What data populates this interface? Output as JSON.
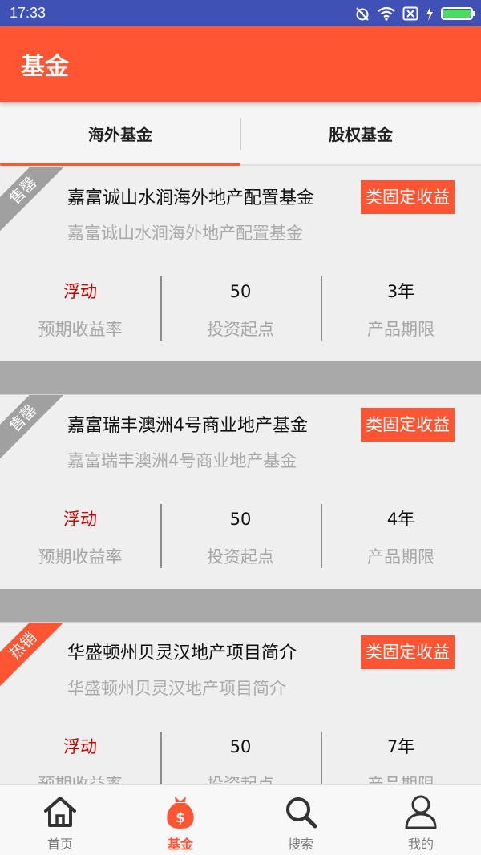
{
  "status_bar": {
    "time": "17:33",
    "battery_color": "#4cd964"
  },
  "app_bar": {
    "title": "基金",
    "color": "#ff5533"
  },
  "tabs": [
    {
      "label": "海外基金",
      "active": true
    },
    {
      "label": "股权基金",
      "active": false
    }
  ],
  "funds": [
    {
      "ribbon": "售罄",
      "name": "嘉富诚山水涧海外地产配置基金",
      "subtitle": "嘉富诚山水涧海外地产配置基金",
      "badge": "类固定收益",
      "stats": [
        {
          "value": "浮动",
          "label": "预期收益率"
        },
        {
          "value": "50",
          "label": "投资起点"
        },
        {
          "value": "3年",
          "label": "产品期限"
        }
      ]
    },
    {
      "ribbon": "售罄",
      "name": "嘉富瑞丰澳洲4号商业地产基金",
      "subtitle": "嘉富瑞丰澳洲4号商业地产基金",
      "badge": "类固定收益",
      "stats": [
        {
          "value": "浮动",
          "label": "预期收益率"
        },
        {
          "value": "50",
          "label": "投资起点"
        },
        {
          "value": "4年",
          "label": "产品期限"
        }
      ]
    },
    {
      "ribbon": "热销",
      "name": "华盛顿州贝灵汉地产项目简介",
      "subtitle": "华盛顿州贝灵汉地产项目简介",
      "badge": "类固定收益",
      "stats": [
        {
          "value": "浮动",
          "label": "预期收益率"
        },
        {
          "value": "50",
          "label": "投资起点"
        },
        {
          "value": "7年",
          "label": "产品期限"
        }
      ]
    }
  ],
  "bottom_nav": [
    {
      "label": "首页",
      "icon": "home-icon",
      "active": false
    },
    {
      "label": "基金",
      "icon": "money-bag-icon",
      "active": true
    },
    {
      "label": "搜索",
      "icon": "search-icon",
      "active": false
    },
    {
      "label": "我的",
      "icon": "user-icon",
      "active": false
    }
  ]
}
